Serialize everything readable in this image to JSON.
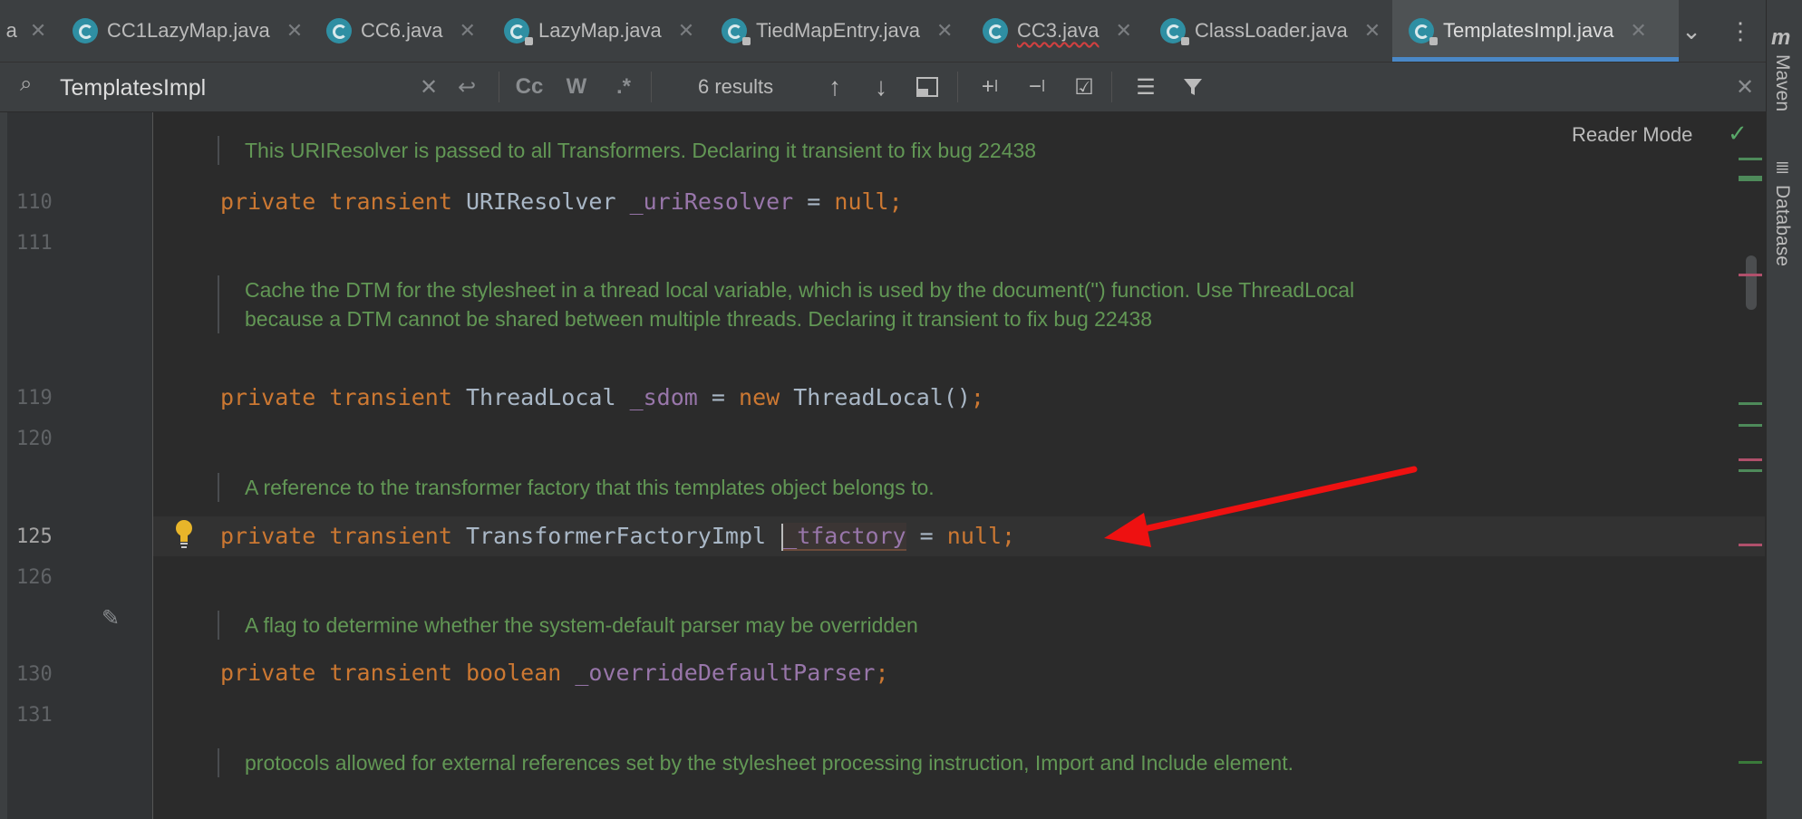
{
  "tabs": [
    {
      "label": "CC1LazyMap.java",
      "lock": false,
      "active": false,
      "error": false
    },
    {
      "label": "CC6.java",
      "lock": false,
      "active": false,
      "error": false
    },
    {
      "label": "LazyMap.java",
      "lock": true,
      "active": false,
      "error": false
    },
    {
      "label": "TiedMapEntry.java",
      "lock": true,
      "active": false,
      "error": false
    },
    {
      "label": "CC3.java",
      "lock": false,
      "active": false,
      "error": true
    },
    {
      "label": "ClassLoader.java",
      "lock": true,
      "active": false,
      "error": false
    },
    {
      "label": "TemplatesImpl.java",
      "lock": true,
      "active": true,
      "error": false
    }
  ],
  "partial_tab_label": "a",
  "find": {
    "query": "TemplatesImpl",
    "match_case": "Cc",
    "words": "W",
    "regex": ".*",
    "results": "6 results"
  },
  "editor": {
    "reader_mode": "Reader Mode",
    "docs": [
      "This URIResolver is passed to all Transformers. Declaring it transient to fix bug 22438",
      "Cache the DTM for the stylesheet in a thread local variable, which is used by the document('') function. Use ThreadLocal because a DTM cannot be shared between multiple threads. Declaring it transient to fix bug 22438",
      "A reference to the transformer factory that this templates object belongs to.",
      "A flag to determine whether the system-default parser may be overridden",
      "protocols allowed for external references set by the stylesheet processing instruction, Import and Include element."
    ],
    "line_numbers": [
      "110",
      "111",
      "119",
      "120",
      "125",
      "126",
      "130",
      "131"
    ],
    "code": {
      "l110": {
        "kw": "private transient",
        "type": "URIResolver",
        "field": "_uriResolver",
        "eq": "=",
        "value": "null",
        "end": ";"
      },
      "l119": {
        "kw": "private transient",
        "type": "ThreadLocal",
        "field": "_sdom",
        "eq": "=",
        "new": "new",
        "ctor": "ThreadLocal()",
        "end": ";"
      },
      "l125": {
        "kw": "private transient",
        "type": "TransformerFactoryImpl",
        "field": "_tfactory",
        "eq": "=",
        "value": "null",
        "end": ";"
      },
      "l130": {
        "kw": "private transient",
        "type": "boolean",
        "field": "_overrideDefaultParser",
        "end": ";"
      }
    }
  },
  "tool_windows": [
    "Maven",
    "Database"
  ],
  "colors": {
    "accent": "#4a88c7",
    "keyword": "#cc7832",
    "field": "#9876aa",
    "doc": "#629755",
    "arrow": "#ee1111"
  }
}
